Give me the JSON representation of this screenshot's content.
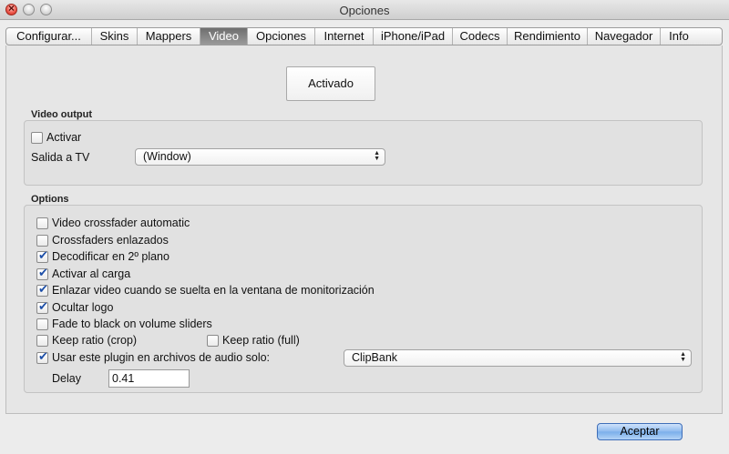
{
  "window": {
    "title": "Opciones"
  },
  "tabs": [
    {
      "label": "Configurar...",
      "name": "tab-configurar",
      "active": false,
      "width": 94
    },
    {
      "label": "Skins",
      "name": "tab-skins",
      "active": false,
      "width": 50
    },
    {
      "label": "Mappers",
      "name": "tab-mappers",
      "active": false,
      "width": 69
    },
    {
      "label": "Video",
      "name": "tab-video",
      "active": true,
      "width": 52
    },
    {
      "label": "Opciones",
      "name": "tab-opciones",
      "active": false,
      "width": 74
    },
    {
      "label": "Internet",
      "name": "tab-internet",
      "active": false,
      "width": 64
    },
    {
      "label": "iPhone/iPad",
      "name": "tab-iphone-ipad",
      "active": false,
      "width": 87
    },
    {
      "label": "Codecs",
      "name": "tab-codecs",
      "active": false,
      "width": 60
    },
    {
      "label": "Rendimiento",
      "name": "tab-rendimiento",
      "active": false,
      "width": 88
    },
    {
      "label": "Navegador",
      "name": "tab-navegador",
      "active": false,
      "width": 80
    },
    {
      "label": "Info",
      "name": "tab-info",
      "active": false,
      "width": 40
    }
  ],
  "activation_button": "Activado",
  "video_output": {
    "title": "Video output",
    "activar": {
      "label": "Activar",
      "checked": false
    },
    "salida_tv": {
      "label": "Salida a TV",
      "value": "(Window)"
    }
  },
  "options": {
    "title": "Options",
    "items": [
      {
        "label": "Video crossfader automatic",
        "checked": false
      },
      {
        "label": "Crossfaders enlazados",
        "checked": false
      },
      {
        "label": "Decodificar en 2º plano",
        "checked": true
      },
      {
        "label": "Activar al carga",
        "checked": true
      },
      {
        "label": "Enlazar video cuando se suelta en la ventana de monitorización",
        "checked": true
      },
      {
        "label": "Ocultar logo",
        "checked": true
      },
      {
        "label": "Fade to black on volume sliders",
        "checked": false
      }
    ],
    "keep_ratio_crop": {
      "label": "Keep ratio (crop)",
      "checked": false
    },
    "keep_ratio_full": {
      "label": "Keep ratio (full)",
      "checked": false
    },
    "audio_plugin": {
      "label": "Usar este plugin en archivos de audio solo:",
      "checked": true,
      "value": "ClipBank"
    },
    "delay": {
      "label": "Delay",
      "value": "0.41"
    }
  },
  "footer": {
    "accept_label": "Aceptar"
  }
}
